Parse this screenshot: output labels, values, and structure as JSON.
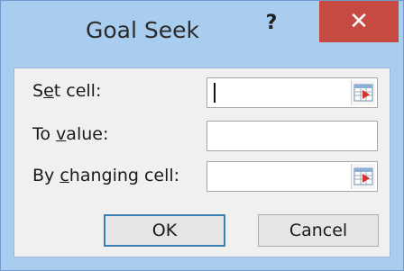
{
  "dialog": {
    "title": "Goal Seek",
    "help_glyph": "?",
    "close_glyph": "✕"
  },
  "fields": [
    {
      "label_pre": "S",
      "label_key": "e",
      "label_post": "t cell:",
      "value": "",
      "has_refedit": true
    },
    {
      "label_pre": "To ",
      "label_key": "v",
      "label_post": "alue:",
      "value": "",
      "has_refedit": false
    },
    {
      "label_pre": "By ",
      "label_key": "c",
      "label_post": "hanging cell:",
      "value": "",
      "has_refedit": true
    }
  ],
  "buttons": {
    "ok": "OK",
    "cancel": "Cancel"
  },
  "colors": {
    "frame": "#a9cdee",
    "close": "#c74a42",
    "client": "#f0f0f0"
  },
  "icons": {
    "refedit": "collapse-dialog-icon"
  }
}
